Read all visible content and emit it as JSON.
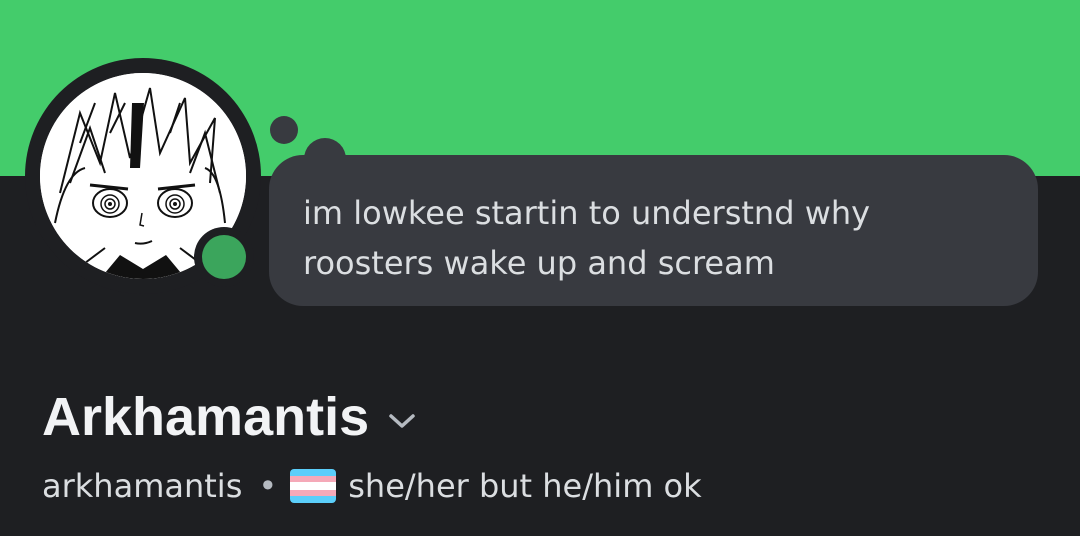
{
  "colors": {
    "banner": "#44cc6b",
    "background": "#1e1f22",
    "bubble": "#383a40",
    "status_online": "#3ba55c",
    "flag_blue": "#5bcefa",
    "flag_pink": "#f5a9b8",
    "flag_white": "#ffffff"
  },
  "status": {
    "text": "im lowkee startin to understnd why roosters wake up and scream"
  },
  "profile": {
    "display_name": "Arkhamantis",
    "username": "arkhamantis",
    "separator": "•",
    "pronouns_flag_icon": "transgender-flag-icon",
    "pronouns": "she/her but he/him ok",
    "presence": "online"
  }
}
